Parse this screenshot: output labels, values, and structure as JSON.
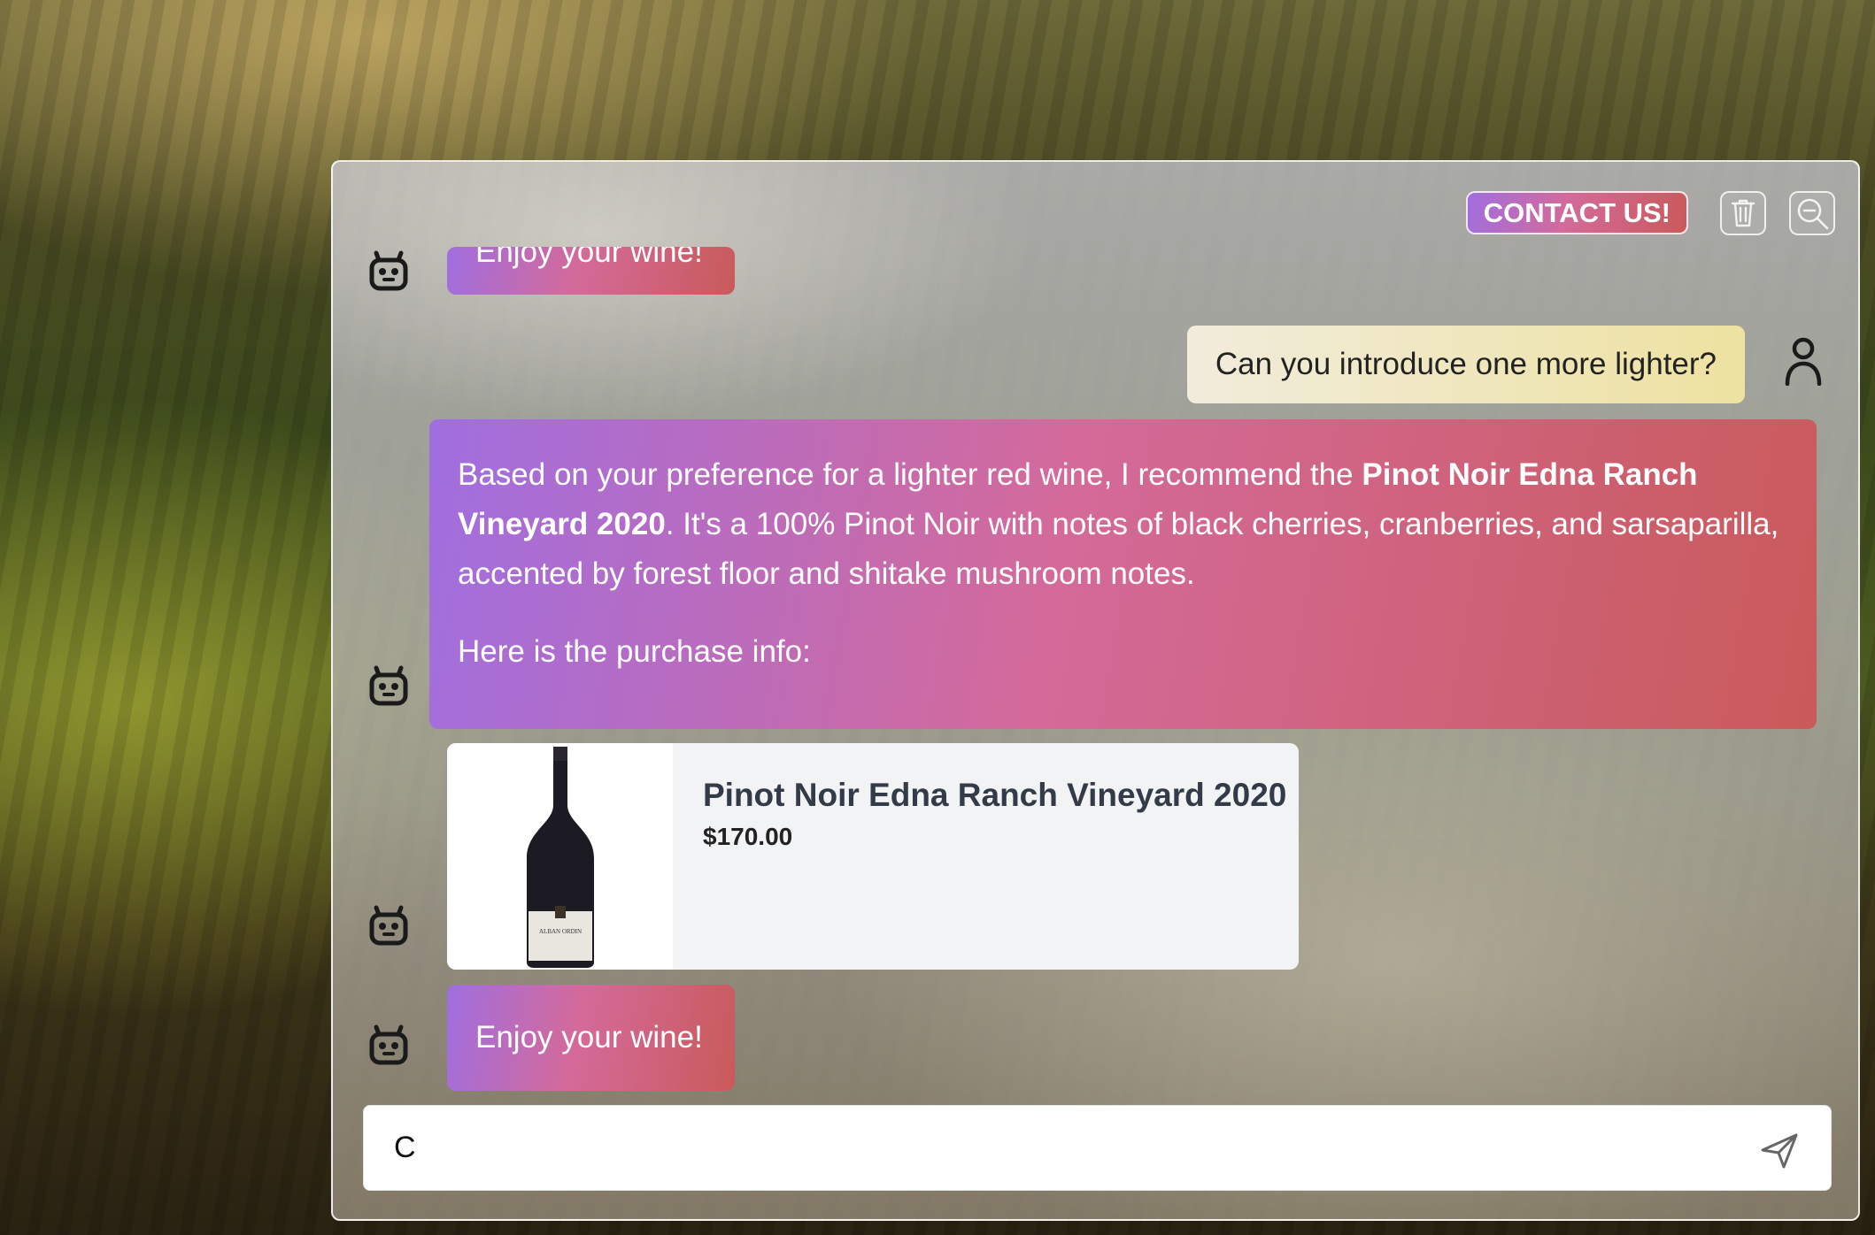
{
  "header": {
    "contact_label": "CONTACT US!",
    "clear_icon": "trash-icon",
    "zoom_icon": "zoom-out-icon"
  },
  "messages": {
    "bot_top_partial": "Enjoy your wine!",
    "user_question": "Can you introduce one more lighter?",
    "bot_reply": {
      "intro": "Based on your preference for a lighter red wine, I recommend the ",
      "wine_bold": "Pinot Noir Edna Ranch Vineyard 2020",
      "details": ". It's a 100% Pinot Noir with notes of black cherries, cranberries, and sarsaparilla, accented by forest floor and shitake mushroom notes.",
      "purchase_info": "Here is the purchase info:"
    },
    "product": {
      "name": "Pinot Noir Edna Ranch Vineyard 2020",
      "price": "$170.00",
      "label_text": "ALBAN ORDIN"
    },
    "bot_closing": "Enjoy your wine!"
  },
  "composer": {
    "value": "C",
    "send_icon": "send-icon"
  },
  "colors": {
    "bot_gradient_start": "#a06ee0",
    "bot_gradient_mid": "#d46a9a",
    "bot_gradient_end": "#c95a5a",
    "user_bubble": "#eee2a0"
  }
}
